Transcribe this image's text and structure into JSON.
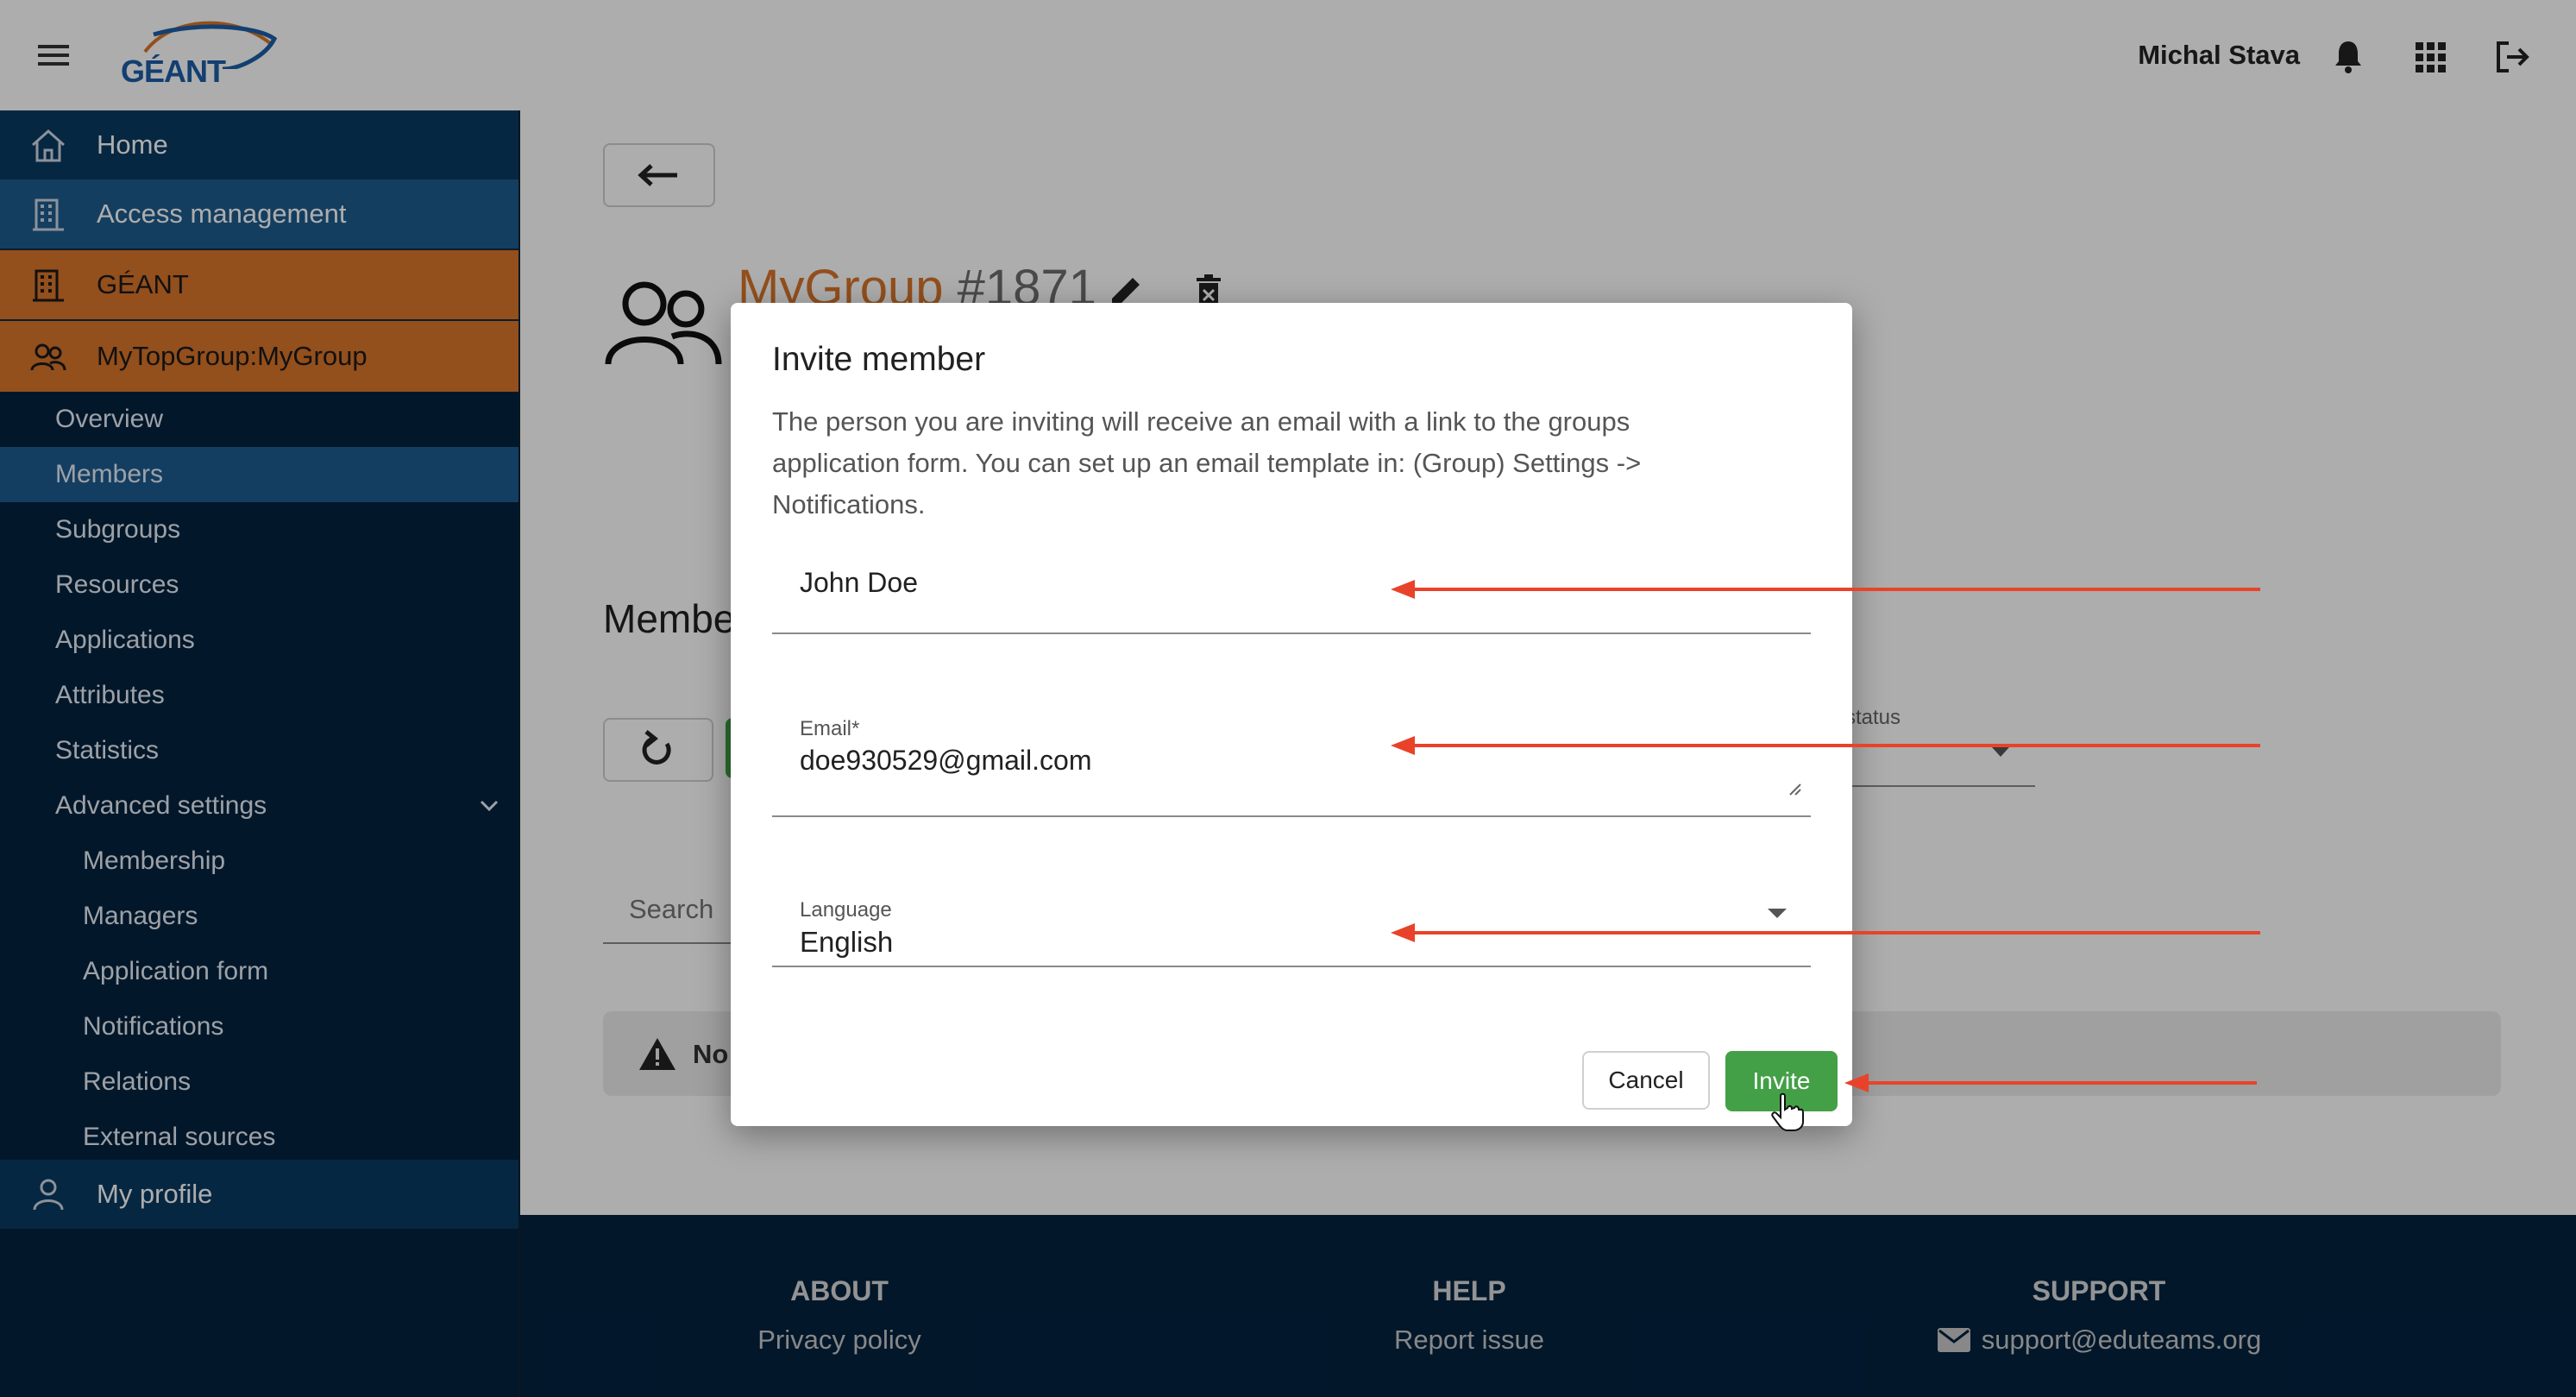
{
  "header": {
    "logo_text": "GÉANT",
    "user_name": "Michal Stava",
    "icons": [
      "menu-icon",
      "bell-icon",
      "apps-grid-icon",
      "logout-icon"
    ]
  },
  "sidebar": {
    "items": [
      {
        "label": "Home",
        "icon": "home-icon"
      },
      {
        "label": "Access management",
        "icon": "building-icon"
      },
      {
        "label": "GÉANT",
        "icon": "building-icon"
      },
      {
        "label": "MyTopGroup:MyGroup",
        "icon": "group-icon"
      }
    ],
    "group_sub_items": [
      "Overview",
      "Members",
      "Subgroups",
      "Resources",
      "Applications",
      "Attributes",
      "Statistics",
      "Advanced settings"
    ],
    "active_sub_item": "Members",
    "advanced_sub_items": [
      "Membership",
      "Managers",
      "Application form",
      "Notifications",
      "Relations",
      "External sources"
    ],
    "profile_label": "My profile"
  },
  "main": {
    "group_name": "MyGroup",
    "group_id": "#1871",
    "members_heading": "Members",
    "status_label": "status",
    "search_placeholder": "Search",
    "alert_text": "No"
  },
  "dialog": {
    "title": "Invite member",
    "description": "The person you are inviting will receive an email with a link to the groups\napplication form. You can set up an email template in: (Group) Settings ->\nNotifications.",
    "name_value": "John Doe",
    "email_label": "Email*",
    "email_value": "doe930529@gmail.com",
    "language_label": "Language",
    "language_value": "English",
    "cancel_label": "Cancel",
    "invite_label": "Invite"
  },
  "footer": {
    "about_heading": "ABOUT",
    "about_link": "Privacy policy",
    "help_heading": "HELP",
    "help_link": "Report issue",
    "support_heading": "SUPPORT",
    "support_email": "support@eduteams.org"
  },
  "colors": {
    "sidebar_bg": "#03223f",
    "active_blue": "#1c5c91",
    "group_orange": "#d9752a",
    "invite_green": "#43a047",
    "annotation_arrow": "#e8432a"
  }
}
